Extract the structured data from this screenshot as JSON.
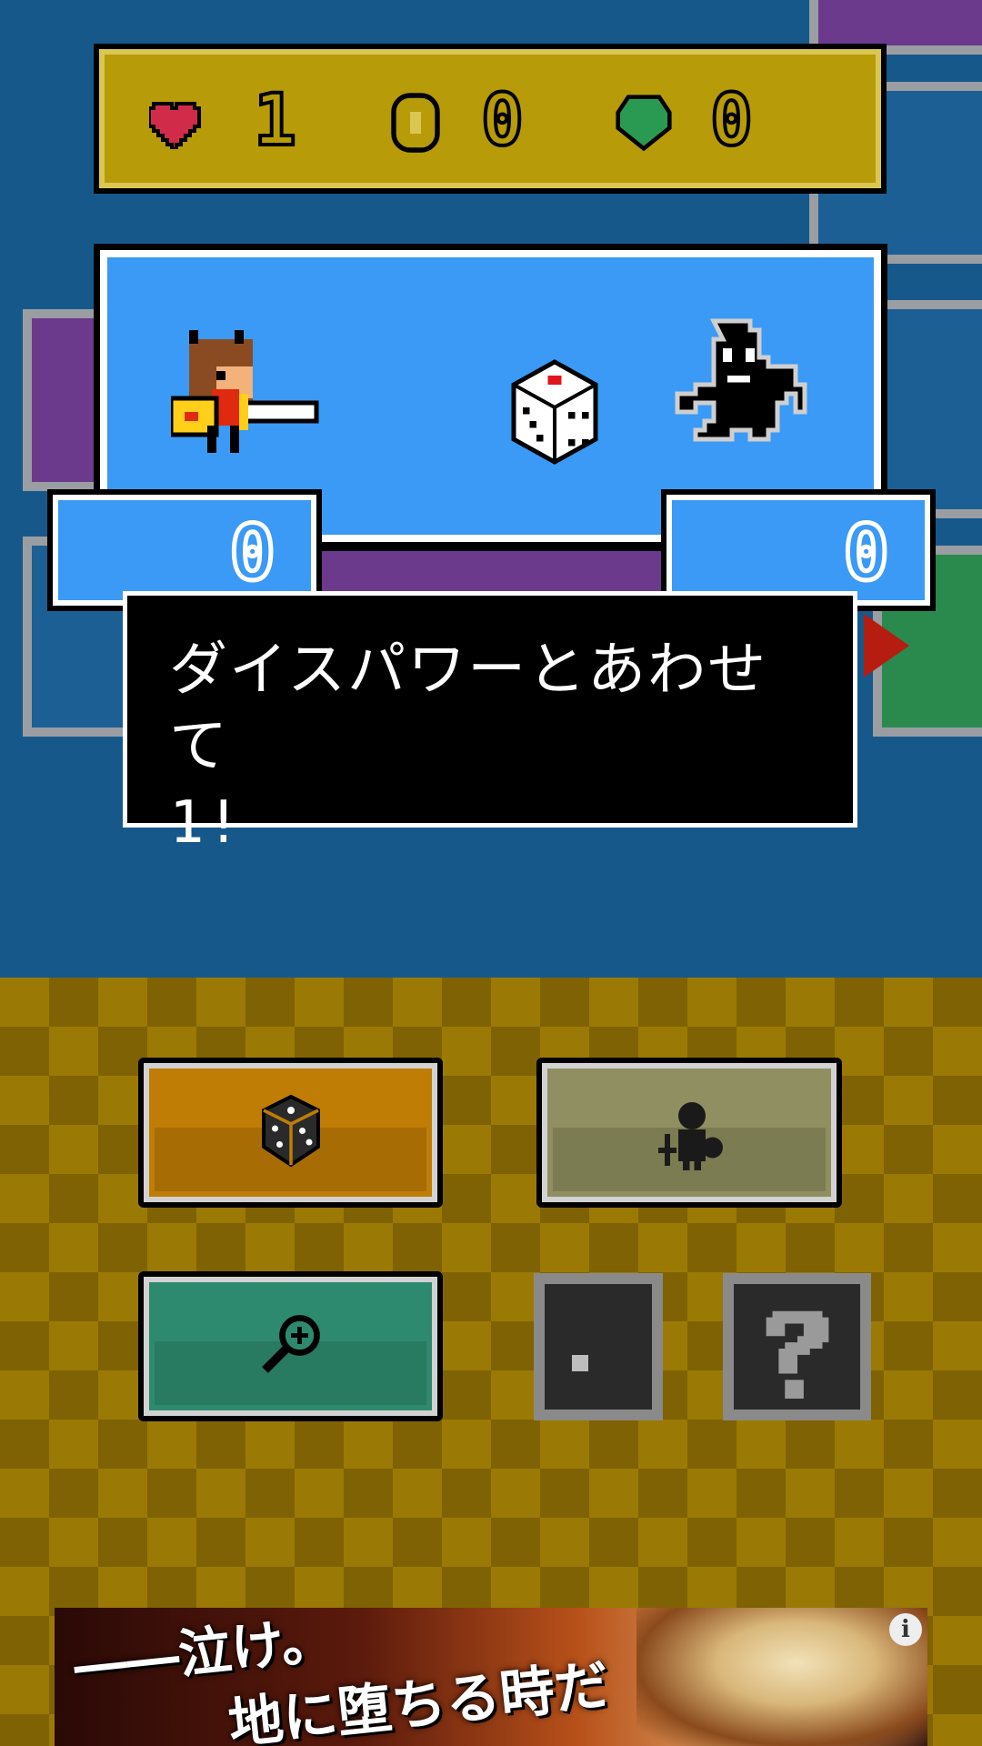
{
  "status": {
    "lives": "1",
    "coins": "0",
    "gems": "0"
  },
  "battle": {
    "player_score": "0",
    "enemy_score": "0"
  },
  "message": {
    "text": "ダイスパワーとあわせて\n1!"
  },
  "buttons": [
    {
      "name": "roll-dice-button",
      "icon": "dice-icon"
    },
    {
      "name": "equipment-button",
      "icon": "knight-icon"
    },
    {
      "name": "zoom-button",
      "icon": "magnifier-icon"
    },
    {
      "name": "item-slot",
      "icon": "dot-icon"
    },
    {
      "name": "help-button",
      "icon": "question-icon"
    }
  ],
  "ad": {
    "line1": "――泣け。",
    "line2": "地に堕ちる時だ",
    "info_icon": "i"
  },
  "colors": {
    "board_bg": "#17588b",
    "battle_bg": "#3a9af5",
    "status_bg": "#b79b08",
    "dice_btn": "#c07d06",
    "equip_btn": "#8f8f62",
    "zoom_btn": "#2e8a6e"
  }
}
